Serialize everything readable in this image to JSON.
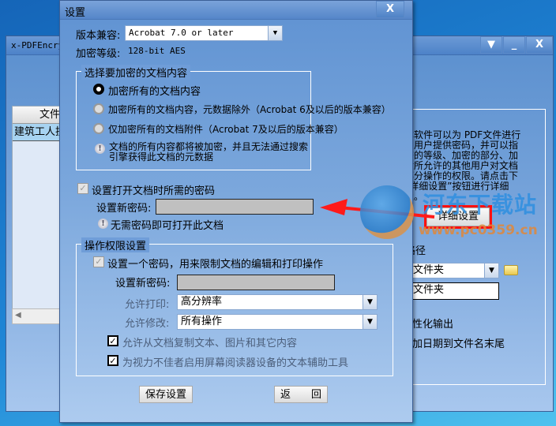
{
  "main_window": {
    "title": "x-PDFEncry",
    "controls": [
      "▼",
      "_",
      "X"
    ],
    "file_list": {
      "header": "文件",
      "rows": [
        "建筑工人技"
      ]
    },
    "description": "本软件可以为 PDF文件进行\n。用户提供密码，并可以指\n密的等级、加密的部分、加\n后所允许的其他用户对文档\n部分操作的权限。请点击下\n“详细设置”按钮进行详细\n置。",
    "detail_button": "详细设置",
    "path_label": "路径",
    "folder_combo": "文件夹",
    "folder_input": "文件夹",
    "output_label": "性化输出",
    "date_label": "加日期到文件名末尾"
  },
  "dialog": {
    "title": "设置",
    "close": "X",
    "version_label": "版本兼容:",
    "version_value": "Acrobat 7.0 or later",
    "level_label": "加密等级:",
    "level_value": "128-bit AES",
    "content_group": {
      "title": "选择要加密的文档内容",
      "options": [
        {
          "label": "加密所有的文档内容",
          "selected": true
        },
        {
          "label": "加密所有的文档内容，元数据除外（Acrobat 6及以后的版本兼容）",
          "selected": false
        },
        {
          "label": "仅加密所有的文档附件（Acrobat 7及以后的版本兼容）",
          "selected": false
        }
      ],
      "note": "文档的所有内容都将被加密，并且无法通过搜索引擎获得此文档的元数据"
    },
    "open_password": {
      "checkbox_label": "设置打开文档时所需的密码",
      "checked": true,
      "field_label": "设置新密码:",
      "note": "无需密码即可打开此文档"
    },
    "permissions": {
      "title": "操作权限设置",
      "checkbox_label": "设置一个密码，用来限制文档的编辑和打印操作",
      "checked": true,
      "field_label": "设置新密码:",
      "print_label": "允许打印:",
      "print_value": "高分辨率",
      "modify_label": "允许修改:",
      "modify_value": "所有操作",
      "copy_label": "允许从文档复制文本、图片和其它内容",
      "copy_checked": true,
      "reader_label": "为视力不佳者启用屏幕阅读器设备的文本辅助工具",
      "reader_checked": true
    },
    "save_button": "保存设置",
    "back_button": "返　　回"
  },
  "watermark": {
    "name": "河东下载站",
    "url": "www.pc0359.cn"
  },
  "colors": {
    "highlight": "#ff0000",
    "accent": "#5f92d2"
  }
}
